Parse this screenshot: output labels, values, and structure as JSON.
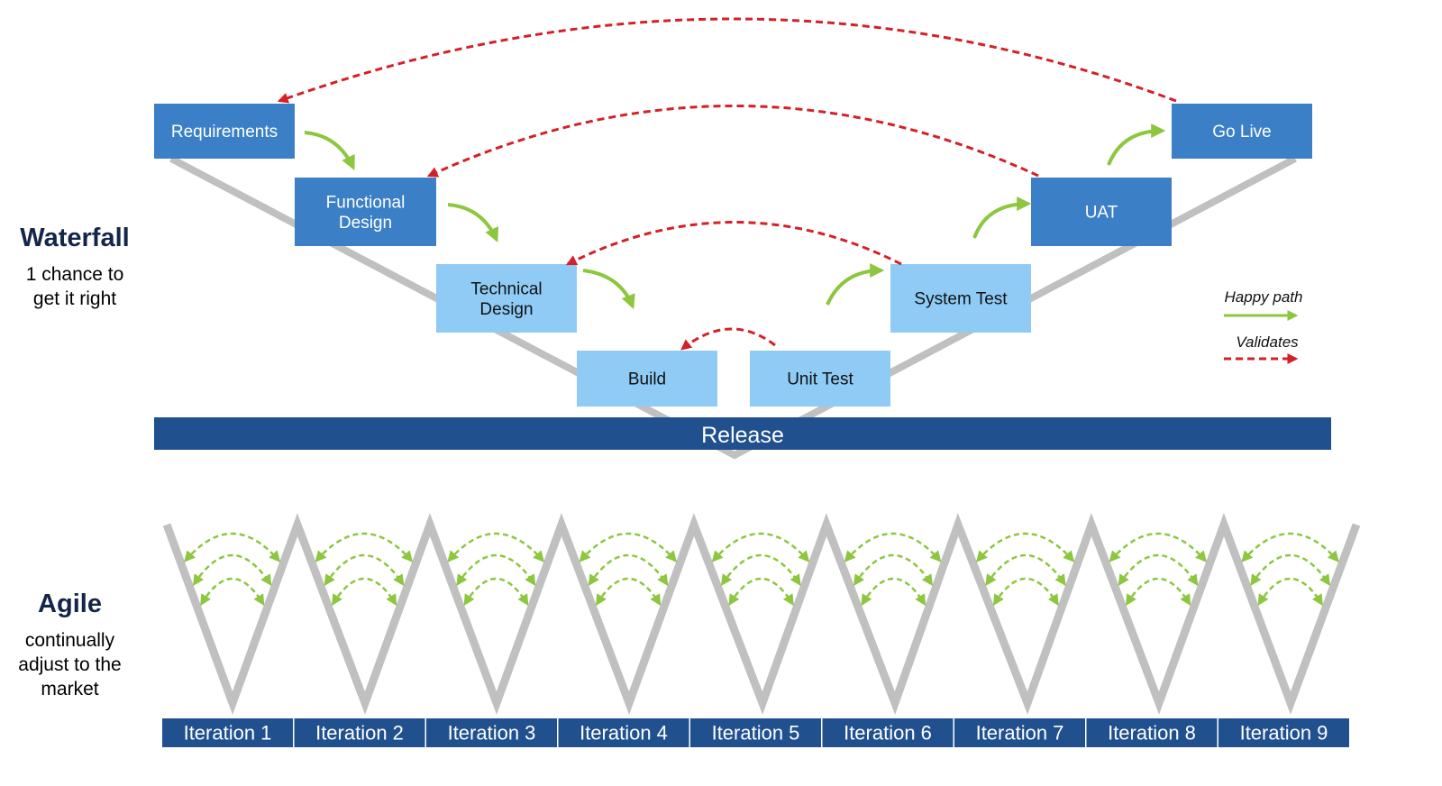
{
  "waterfall": {
    "title": "Waterfall",
    "subtitle": "1 chance to get it right",
    "stages": [
      {
        "label": "Requirements",
        "shade": "dark"
      },
      {
        "label": "Functional Design",
        "shade": "dark"
      },
      {
        "label": "Technical Design",
        "shade": "light"
      },
      {
        "label": "Build",
        "shade": "light"
      },
      {
        "label": "Unit Test",
        "shade": "light"
      },
      {
        "label": "System Test",
        "shade": "light"
      },
      {
        "label": "UAT",
        "shade": "dark"
      },
      {
        "label": "Go Live",
        "shade": "dark"
      }
    ],
    "release": "Release"
  },
  "agile": {
    "title": "Agile",
    "subtitle": "continually adjust to the market",
    "iterations": [
      "Iteration 1",
      "Iteration 2",
      "Iteration 3",
      "Iteration 4",
      "Iteration 5",
      "Iteration 6",
      "Iteration 7",
      "Iteration 8",
      "Iteration 9"
    ]
  },
  "legend": {
    "happy_path": "Happy path",
    "validates": "Validates"
  },
  "colors": {
    "dark_box": "#3b7fc6",
    "light_box": "#8fcbf5",
    "release_bar": "#21508f",
    "v_line": "#c0c0c0",
    "happy_path": "#8dc63f",
    "validates": "#d42027"
  }
}
